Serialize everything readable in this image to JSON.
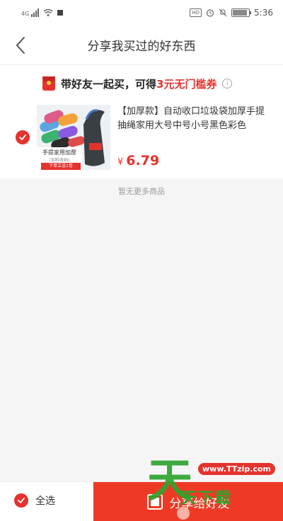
{
  "status_bar": {
    "network": "4G",
    "hd": "HD",
    "battery_text": "",
    "time": "5:36"
  },
  "nav": {
    "title": "分享我买过的好东西",
    "back_icon": "chevron-left-icon"
  },
  "promo": {
    "text_prefix": "带好友一起买，可得",
    "text_accent": "3元无门槛券",
    "accent_color": "#e5322d"
  },
  "product": {
    "title": "【加厚款】自动收口垃圾袋加厚手提抽绳家用大号中号小号黑色彩色",
    "currency": "¥",
    "price": "6.79",
    "image_caption": "手提家用加厚",
    "image_subcaption": "(加料收纳)",
    "image_tag": "下单立送1卷",
    "selected": true
  },
  "list_footer": "暂无更多商品",
  "bottom_bar": {
    "select_all_label": "全选",
    "share_label": "分享给好友",
    "share_color": "#ee3a24"
  },
  "watermark": {
    "url": "www.TTzip.com",
    "big_char": "天",
    "rest_text": "天下载"
  }
}
